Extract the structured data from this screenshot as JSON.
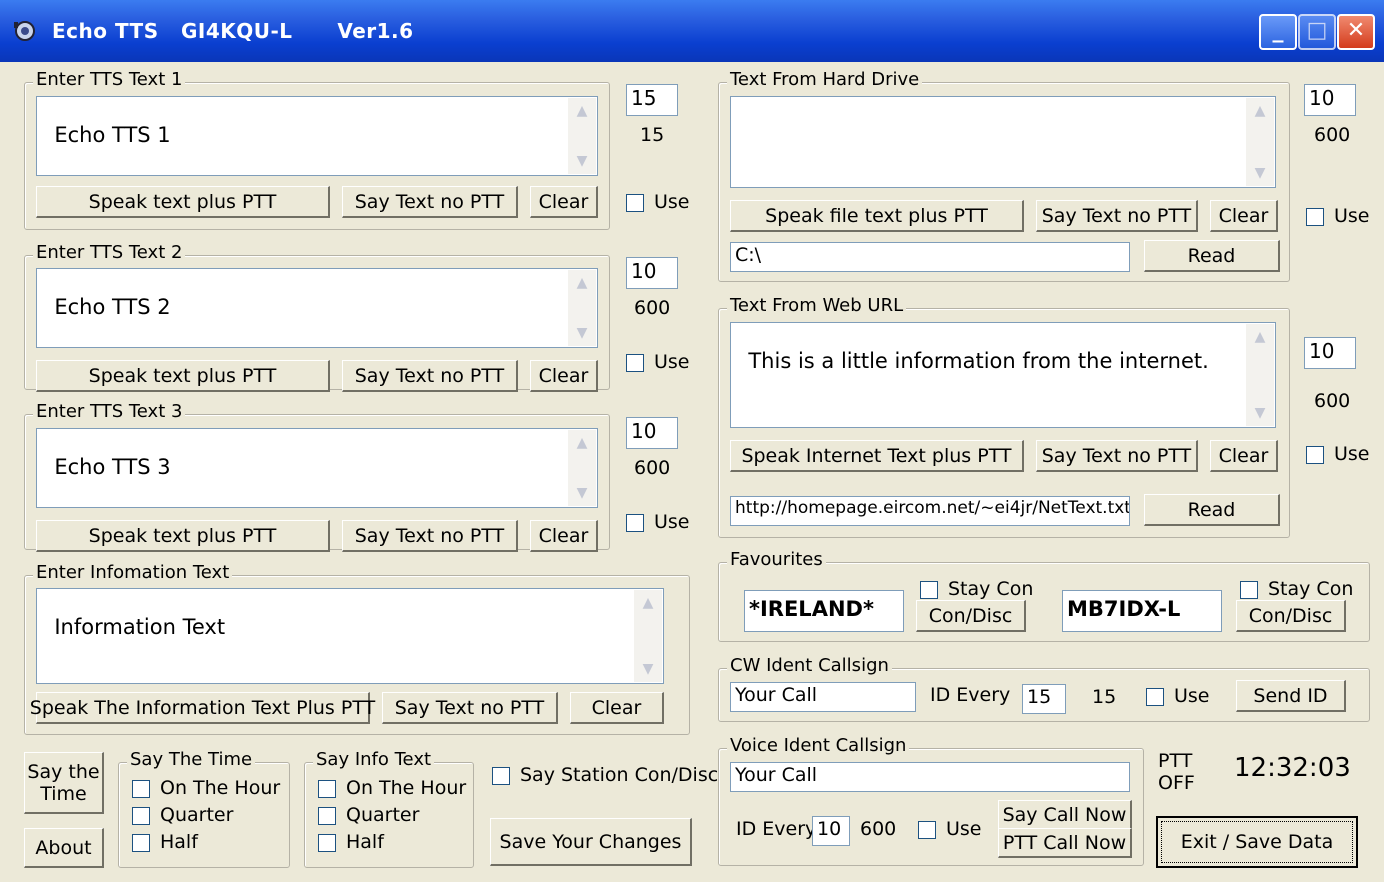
{
  "window": {
    "title": "Echo TTS   GI4KQU-L      Ver1.6",
    "minimize": "_",
    "maximize": "□",
    "close": "✕"
  },
  "tts1": {
    "legend": "Enter TTS Text 1",
    "text": "Echo TTS 1",
    "speak": "Speak text plus PTT",
    "say": "Say Text no PTT",
    "clear": "Clear",
    "interval": "15",
    "interval_label": "15",
    "use": "Use"
  },
  "tts2": {
    "legend": "Enter TTS Text 2",
    "text": "Echo TTS 2",
    "speak": "Speak text plus PTT",
    "say": "Say Text no PTT",
    "clear": "Clear",
    "interval": "10",
    "interval_label": "600",
    "use": "Use"
  },
  "tts3": {
    "legend": "Enter TTS Text 3",
    "text": "Echo TTS 3",
    "speak": "Speak text plus PTT",
    "say": "Say Text no PTT",
    "clear": "Clear",
    "interval": "10",
    "interval_label": "600",
    "use": "Use"
  },
  "info": {
    "legend": "Enter Infomation Text",
    "text": "Information Text",
    "speak": "Speak The Information Text Plus PTT",
    "say": "Say Text no PTT",
    "clear": "Clear"
  },
  "bottom_left": {
    "say_time_btn": "Say the\nTime",
    "about_btn": "About",
    "say_time_group": "Say The Time",
    "say_info_group": "Say Info Text",
    "on_the_hour": "On The Hour",
    "quarter": "Quarter",
    "half": "Half",
    "say_station": "Say  Station Con/Disc",
    "save_changes": "Save Your Changes"
  },
  "hard_drive": {
    "legend": "Text From Hard Drive",
    "text": "",
    "speak": "Speak file text plus PTT",
    "say": "Say Text no PTT",
    "clear": "Clear",
    "path": "C:\\",
    "read": "Read",
    "interval": "10",
    "interval_label": "600",
    "use": "Use"
  },
  "web": {
    "legend": "Text From Web URL",
    "text": "This is a little information from the internet.",
    "speak": "Speak Internet Text plus PTT",
    "say": "Say Text no PTT",
    "clear": "Clear",
    "url": "http://homepage.eircom.net/~ei4jr/NetText.txt",
    "read": "Read",
    "interval": "10",
    "interval_label": "600",
    "use": "Use"
  },
  "favourites": {
    "legend": "Favourites",
    "fav1": "*IRELAND*",
    "fav2": "MB7IDX-L",
    "stay_con": "Stay Con",
    "con_disc": "Con/Disc"
  },
  "cw": {
    "legend": "CW Ident Callsign",
    "callsign": "Your Call",
    "id_every": "ID Every",
    "interval": "15",
    "interval_label": "15",
    "use": "Use",
    "send": "Send ID"
  },
  "voice": {
    "legend": "Voice Ident Callsign",
    "callsign": "Your Call",
    "id_every": "ID Every",
    "interval": "10",
    "interval_label": "600",
    "use": "Use",
    "say_call": "Say Call Now",
    "ptt_call": "PTT Call Now"
  },
  "status": {
    "ptt": "PTT",
    "ptt_state": "OFF",
    "clock": "12:32:03",
    "exit": "Exit / Save Data"
  }
}
